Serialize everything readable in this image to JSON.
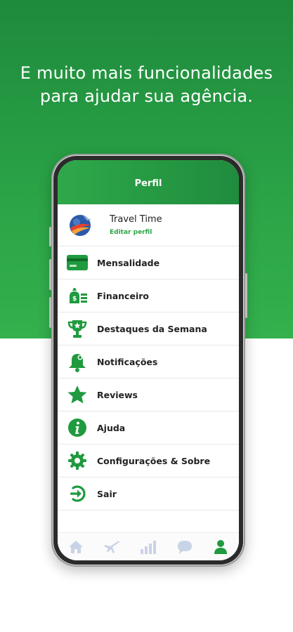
{
  "headline": {
    "line1": "E muito mais funcionalidades",
    "line2": "para ajudar sua agência."
  },
  "app": {
    "title": "Perfil",
    "profile": {
      "name": "Travel Time",
      "edit_label": "Editar perfil"
    },
    "menu": [
      {
        "label": "Mensalidade",
        "icon": "credit-card-icon"
      },
      {
        "label": "Financeiro",
        "icon": "money-bag-icon"
      },
      {
        "label": "Destaques da Semana",
        "icon": "trophy-icon"
      },
      {
        "label": "Notificações",
        "icon": "bell-icon"
      },
      {
        "label": "Reviews",
        "icon": "star-icon"
      },
      {
        "label": "Ajuda",
        "icon": "info-icon"
      },
      {
        "label": "Configurações & Sobre",
        "icon": "gear-icon"
      },
      {
        "label": "Sair",
        "icon": "logout-icon"
      }
    ],
    "tabs": [
      {
        "icon": "home-icon",
        "active": false
      },
      {
        "icon": "airplane-icon",
        "active": false
      },
      {
        "icon": "bar-chart-icon",
        "active": false
      },
      {
        "icon": "chat-icon",
        "active": false
      },
      {
        "icon": "user-icon",
        "active": true
      }
    ]
  },
  "colors": {
    "brand_green": "#2ba447",
    "dark_green": "#1f8c3d",
    "tab_inactive": "#c9d3e6"
  }
}
